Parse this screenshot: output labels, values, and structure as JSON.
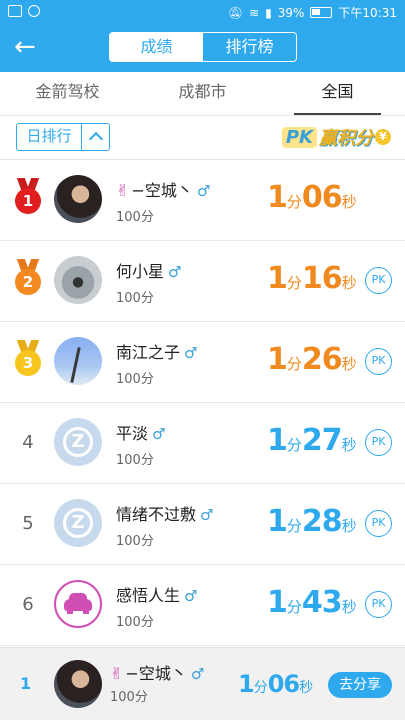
{
  "status": {
    "battery": "39%",
    "time": "下午10:31"
  },
  "appbar": {
    "tabs": [
      "成绩",
      "排行榜"
    ],
    "active_tab": "排行榜"
  },
  "region_tabs": [
    "金箭驾校",
    "成都市",
    "全国"
  ],
  "selected_region": "全国",
  "filter": {
    "label": "日排行",
    "logo_pk": "PK",
    "logo_text": "赢积分",
    "logo_coin": "¥"
  },
  "time_units": {
    "min": "分",
    "sec": "秒"
  },
  "ranking": [
    {
      "rank": "1",
      "name": "−空城丶",
      "prefix_emoji": "✌",
      "gender": "♂",
      "score": "100分",
      "minutes": "1",
      "seconds": "06",
      "pk": false
    },
    {
      "rank": "2",
      "name": "何小星",
      "prefix_emoji": "",
      "gender": "♂",
      "score": "100分",
      "minutes": "1",
      "seconds": "16",
      "pk": true
    },
    {
      "rank": "3",
      "name": "南江之子",
      "prefix_emoji": "",
      "gender": "♂",
      "score": "100分",
      "minutes": "1",
      "seconds": "26",
      "pk": true
    },
    {
      "rank": "4",
      "name": "平淡",
      "prefix_emoji": "",
      "gender": "♂",
      "score": "100分",
      "minutes": "1",
      "seconds": "27",
      "pk": true
    },
    {
      "rank": "5",
      "name": "情绪不过敷",
      "prefix_emoji": "",
      "gender": "♂",
      "score": "100分",
      "minutes": "1",
      "seconds": "28",
      "pk": true
    },
    {
      "rank": "6",
      "name": "感悟人生",
      "prefix_emoji": "",
      "gender": "♂",
      "score": "100分",
      "minutes": "1",
      "seconds": "43",
      "pk": true
    }
  ],
  "pk_label": "PK",
  "me": {
    "rank": "1",
    "name": "−空城丶",
    "prefix_emoji": "✌",
    "gender": "♂",
    "score": "100分",
    "minutes": "1",
    "seconds": "06",
    "share_label": "去分享"
  },
  "colors": {
    "primary": "#2fa9ee",
    "top3_time": "#f08a1e"
  }
}
